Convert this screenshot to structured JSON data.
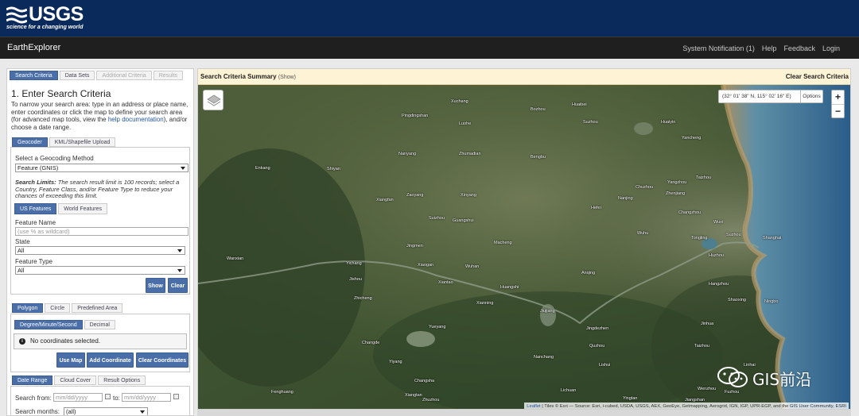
{
  "banner": {
    "logo_text": "USGS",
    "tagline": "science for a changing world"
  },
  "app": {
    "name": "EarthExplorer",
    "nav": [
      "System Notification (1)",
      "Help",
      "Feedback",
      "Login"
    ]
  },
  "left": {
    "tabs": [
      {
        "label": "Search Criteria",
        "active": true
      },
      {
        "label": "Data Sets",
        "active": false
      },
      {
        "label": "Additional Criteria",
        "active": false
      },
      {
        "label": "Results",
        "active": false
      }
    ],
    "heading": "1. Enter Search Criteria",
    "intro_before": "To narrow your search area: type in an address or place name, enter coordinates or click the map to define your search area (for advanced map tools, view the ",
    "intro_link": "help documentation",
    "intro_after": "), and/or choose a date range.",
    "geo_tabs": [
      "Geocoder",
      "KML/Shapefile Upload"
    ],
    "geocoding_label": "Select a Geocoding Method",
    "geocoding_value": "Feature (GNIS)",
    "limits_bold": "Search Limits:",
    "limits_text": " The search result limit is 100 records; select a Country, Feature Class, and/or Feature Type to reduce your chances of exceeding this limit.",
    "feature_tabs": [
      "US Features",
      "World Features"
    ],
    "feature_name_label": "Feature Name",
    "feature_name_placeholder": "(use % as wildcard)",
    "state_label": "State",
    "state_value": "All",
    "feature_type_label": "Feature Type",
    "feature_type_value": "All",
    "show_btn": "Show",
    "clear_btn": "Clear",
    "area_tabs": [
      "Polygon",
      "Circle",
      "Predefined Area"
    ],
    "coord_tabs": [
      "Degree/Minute/Second",
      "Decimal"
    ],
    "info_icon": "i",
    "no_coords": "No coordinates selected.",
    "use_map_btn": "Use Map",
    "add_coord_btn": "Add Coordinate",
    "clear_coords_btn": "Clear Coordinates",
    "date_tabs": [
      "Date Range",
      "Cloud Cover",
      "Result Options"
    ],
    "search_from_label": "Search from:",
    "date_placeholder": "mm/dd/yyyy",
    "to_label": "to:",
    "search_months_label": "Search months:",
    "search_months_value": "(all)"
  },
  "map": {
    "summary_title": "Search Criteria Summary",
    "summary_show": "(Show)",
    "clear_label": "Clear Search Criteria",
    "coords": "(32° 01' 38\" N, 115° 02' 16\" E)",
    "options": "Options",
    "zoom_in": "+",
    "zoom_out": "−",
    "attribution_link": "Leaflet",
    "attribution_text": " | Tiles © Esri — Source: Esri, i-cubed, USDA, USGS, AEX, GeoEye, Getmapping, Aerogrid, IGN, IGP, UPR-EGP, and the GIS User Community, ESRI",
    "cities": [
      {
        "name": "Xuchang"
      },
      {
        "name": "Bozhou"
      },
      {
        "name": "Huaibei"
      },
      {
        "name": "Pingdingshan"
      },
      {
        "name": "Luohe"
      },
      {
        "name": "Suzhou"
      },
      {
        "name": "Huaiyin"
      },
      {
        "name": "Yancheng"
      },
      {
        "name": "Nanyang"
      },
      {
        "name": "Zhumadian"
      },
      {
        "name": "Bengbu"
      },
      {
        "name": "Shiyan"
      },
      {
        "name": "Enkang"
      },
      {
        "name": "Yangzhou"
      },
      {
        "name": "Taizhou"
      },
      {
        "name": "Xiangfan"
      },
      {
        "name": "Zaoyang"
      },
      {
        "name": "Xinyang"
      },
      {
        "name": "Chuzhou"
      },
      {
        "name": "Nanjing"
      },
      {
        "name": "Zhenjiang"
      },
      {
        "name": "Suizhou"
      },
      {
        "name": "Guangshui"
      },
      {
        "name": "Hefei"
      },
      {
        "name": "Changzhou"
      },
      {
        "name": "Wuxi"
      },
      {
        "name": "Wuhu"
      },
      {
        "name": "Suzhou"
      },
      {
        "name": "Shanghai"
      },
      {
        "name": "Jingmen"
      },
      {
        "name": "Xiaogan"
      },
      {
        "name": "Macheng"
      },
      {
        "name": "Tongling"
      },
      {
        "name": "Huzhou"
      },
      {
        "name": "Wanxian"
      },
      {
        "name": "Yichang"
      },
      {
        "name": "Xiantao"
      },
      {
        "name": "Wuhan"
      },
      {
        "name": "Huangshi"
      },
      {
        "name": "Anqing"
      },
      {
        "name": "Hangzhou"
      },
      {
        "name": "Shaoxing"
      },
      {
        "name": "Ningbo"
      },
      {
        "name": "Jishou"
      },
      {
        "name": "Zhicheng"
      },
      {
        "name": "Yueyang"
      },
      {
        "name": "Xianning"
      },
      {
        "name": "Jiujiang"
      },
      {
        "name": "Changde"
      },
      {
        "name": "Jingdezhen"
      },
      {
        "name": "Jinhua"
      },
      {
        "name": "Quzhou"
      },
      {
        "name": "Taizhou"
      },
      {
        "name": "Yiyang"
      },
      {
        "name": "Nanchang"
      },
      {
        "name": "Lishui"
      },
      {
        "name": "Wenzhou"
      },
      {
        "name": "Changsha"
      },
      {
        "name": "Xiangtan"
      },
      {
        "name": "Zhuzhou"
      },
      {
        "name": "Linhai"
      },
      {
        "name": "Lichuan"
      },
      {
        "name": "Fenghuang"
      },
      {
        "name": "Fuzhou"
      },
      {
        "name": "Yingtan"
      },
      {
        "name": "Jiangshan"
      }
    ]
  },
  "watermark": {
    "text": "GIS前沿"
  },
  "colors": {
    "banner": "#0b2a5c",
    "appbar": "#1f1f1f",
    "accent": "#4a6ea8",
    "summary_bg": "#fff3d6"
  }
}
